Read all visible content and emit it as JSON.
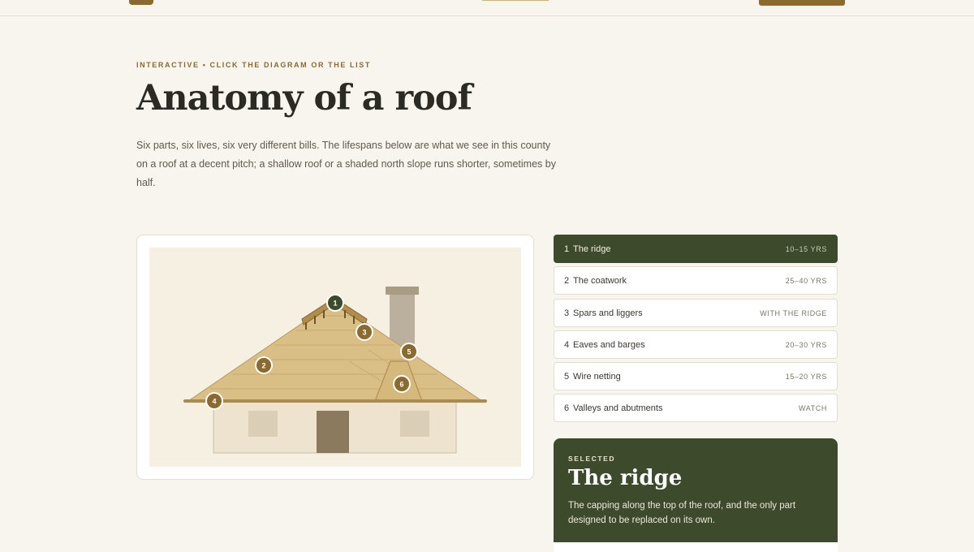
{
  "page": {
    "eyebrow": "INTERACTIVE • CLICK THE DIAGRAM OR THE LIST",
    "title": "Anatomy of a roof",
    "intro": "Six parts, six lives, six very different bills. The lifespans below are what we see in this county on a roof at a decent pitch; a shallow roof or a shaded north slope runs shorter, sometimes by half."
  },
  "colors": {
    "accent": "#8a6a2e",
    "active": "#3d4a2c",
    "thatch": "#d8be84",
    "background": "#f8f5ee"
  },
  "diagram": {
    "markers": [
      {
        "num": "1",
        "part": "The ridge",
        "active": true
      },
      {
        "num": "2",
        "part": "The coatwork"
      },
      {
        "num": "3",
        "part": "Spars and liggers"
      },
      {
        "num": "4",
        "part": "Eaves and barges"
      },
      {
        "num": "5",
        "part": "Wire netting"
      },
      {
        "num": "6",
        "part": "Valleys and abutments"
      }
    ]
  },
  "parts": [
    {
      "num": "1",
      "name": "The ridge",
      "life": "10–15 YRS",
      "active": true
    },
    {
      "num": "2",
      "name": "The coatwork",
      "life": "25–40 YRS"
    },
    {
      "num": "3",
      "name": "Spars and liggers",
      "life": "WITH THE RIDGE"
    },
    {
      "num": "4",
      "name": "Eaves and barges",
      "life": "20–30 YRS"
    },
    {
      "num": "5",
      "name": "Wire netting",
      "life": "15–20 YRS"
    },
    {
      "num": "6",
      "name": "Valleys and abutments",
      "life": "WATCH"
    }
  ],
  "selected": {
    "eyebrow": "SELECTED",
    "title": "The ridge",
    "description": "The capping along the top of the roof, and the only part designed to be replaced on its own."
  }
}
